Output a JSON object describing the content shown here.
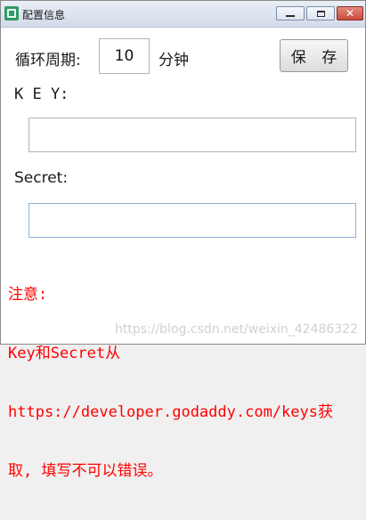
{
  "window": {
    "title": "配置信息"
  },
  "form": {
    "cycle_label": "循环周期:",
    "cycle_value": "10",
    "minute_label": "分钟",
    "save_label": "保 存",
    "key_label": "K E Y:",
    "secret_label": "Secret:"
  },
  "note": {
    "line1": "注意:",
    "line2": "Key和Secret从",
    "line3": "https://developer.godaddy.com/keys获",
    "line4": "取, 填写不可以错误。"
  },
  "watermark": "https://blog.csdn.net/weixin_42486322",
  "colors": {
    "note_text": "#ff0000",
    "window_bg": "#ffffff"
  },
  "icons": [
    "app-icon",
    "minimize-icon",
    "maximize-icon",
    "close-icon"
  ]
}
